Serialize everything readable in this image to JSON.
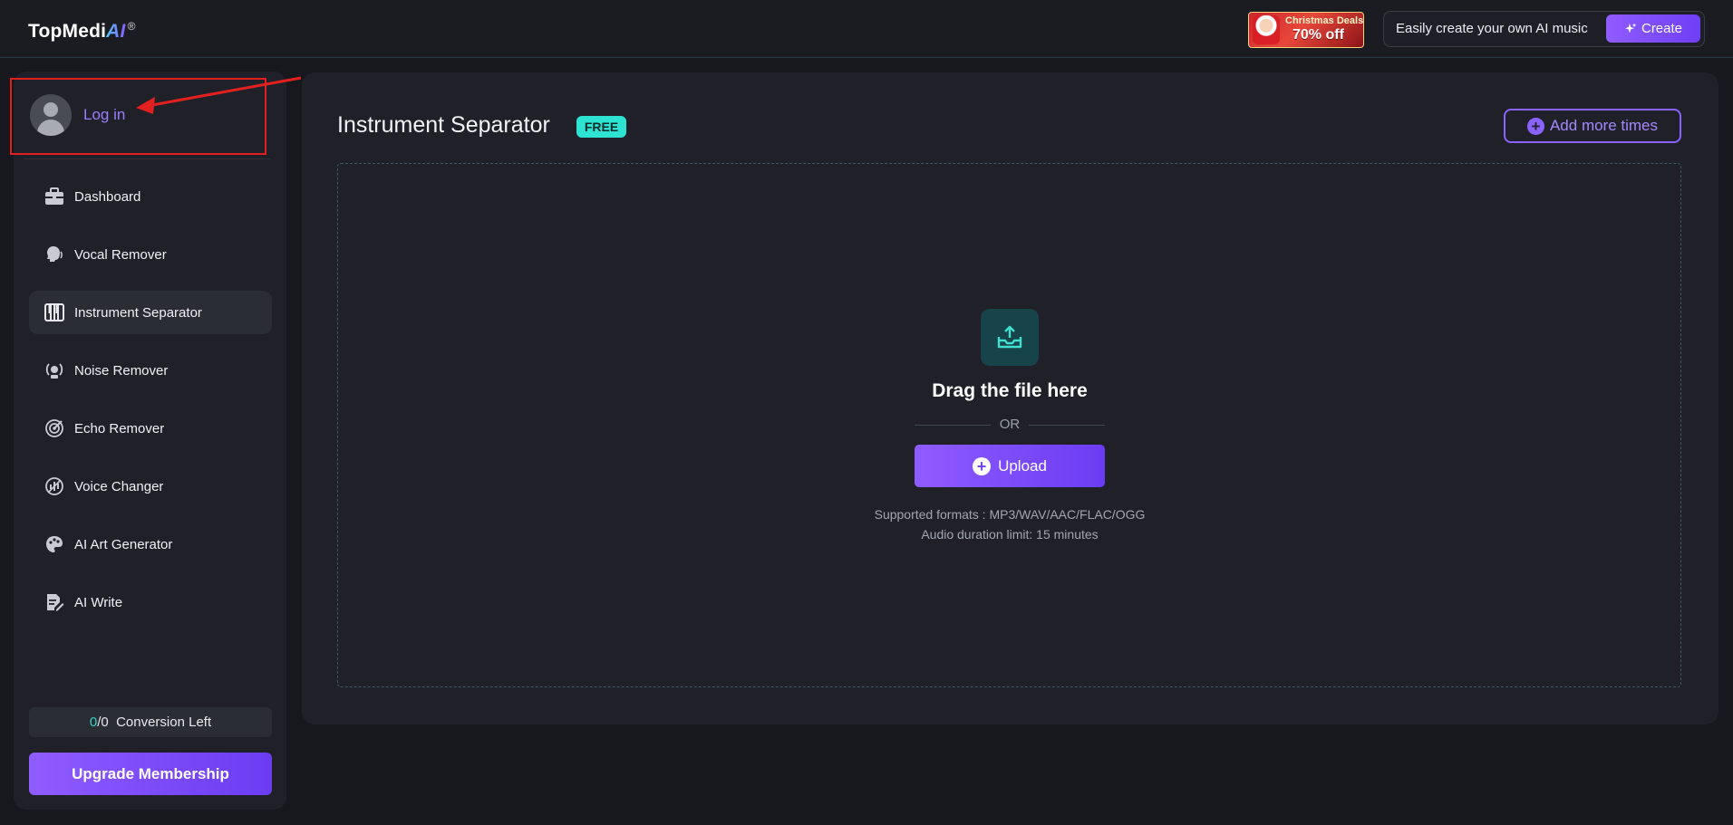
{
  "header": {
    "brand_main": "TopMedi",
    "brand_ai": "AI",
    "brand_reg": "®",
    "promo": {
      "line1": "Christmas Deals",
      "line2": "70% off"
    },
    "create_prompt": "Easily create your own AI music",
    "create_button": "Create"
  },
  "sidebar": {
    "login_label": "Log in",
    "items": [
      {
        "label": "Dashboard",
        "icon": "briefcase-icon"
      },
      {
        "label": "Vocal Remover",
        "icon": "head-voice-icon"
      },
      {
        "label": "Instrument Separator",
        "icon": "piano-keys-icon",
        "active": true
      },
      {
        "label": "Noise Remover",
        "icon": "noise-icon"
      },
      {
        "label": "Echo Remover",
        "icon": "echo-icon"
      },
      {
        "label": "Voice Changer",
        "icon": "voice-changer-icon"
      },
      {
        "label": "AI Art Generator",
        "icon": "palette-icon"
      },
      {
        "label": "AI Write",
        "icon": "write-icon"
      }
    ],
    "conversion": {
      "used": "0",
      "sep": "/",
      "total": "0",
      "label": "Conversion Left"
    },
    "upgrade_button": "Upgrade Membership"
  },
  "main": {
    "title": "Instrument Separator",
    "badge": "FREE",
    "add_more_button": "Add more times",
    "drop": {
      "heading": "Drag the file here",
      "or": "OR",
      "upload_button": "Upload",
      "formats": "Supported formats : MP3/WAV/AAC/FLAC/OGG",
      "duration": "Audio duration limit: 15 minutes"
    }
  },
  "colors": {
    "accent_purple": "#7c4dff",
    "accent_teal": "#2fe3d2",
    "background": "#17181d",
    "panel": "#202128",
    "annotation_red": "#e32020"
  }
}
